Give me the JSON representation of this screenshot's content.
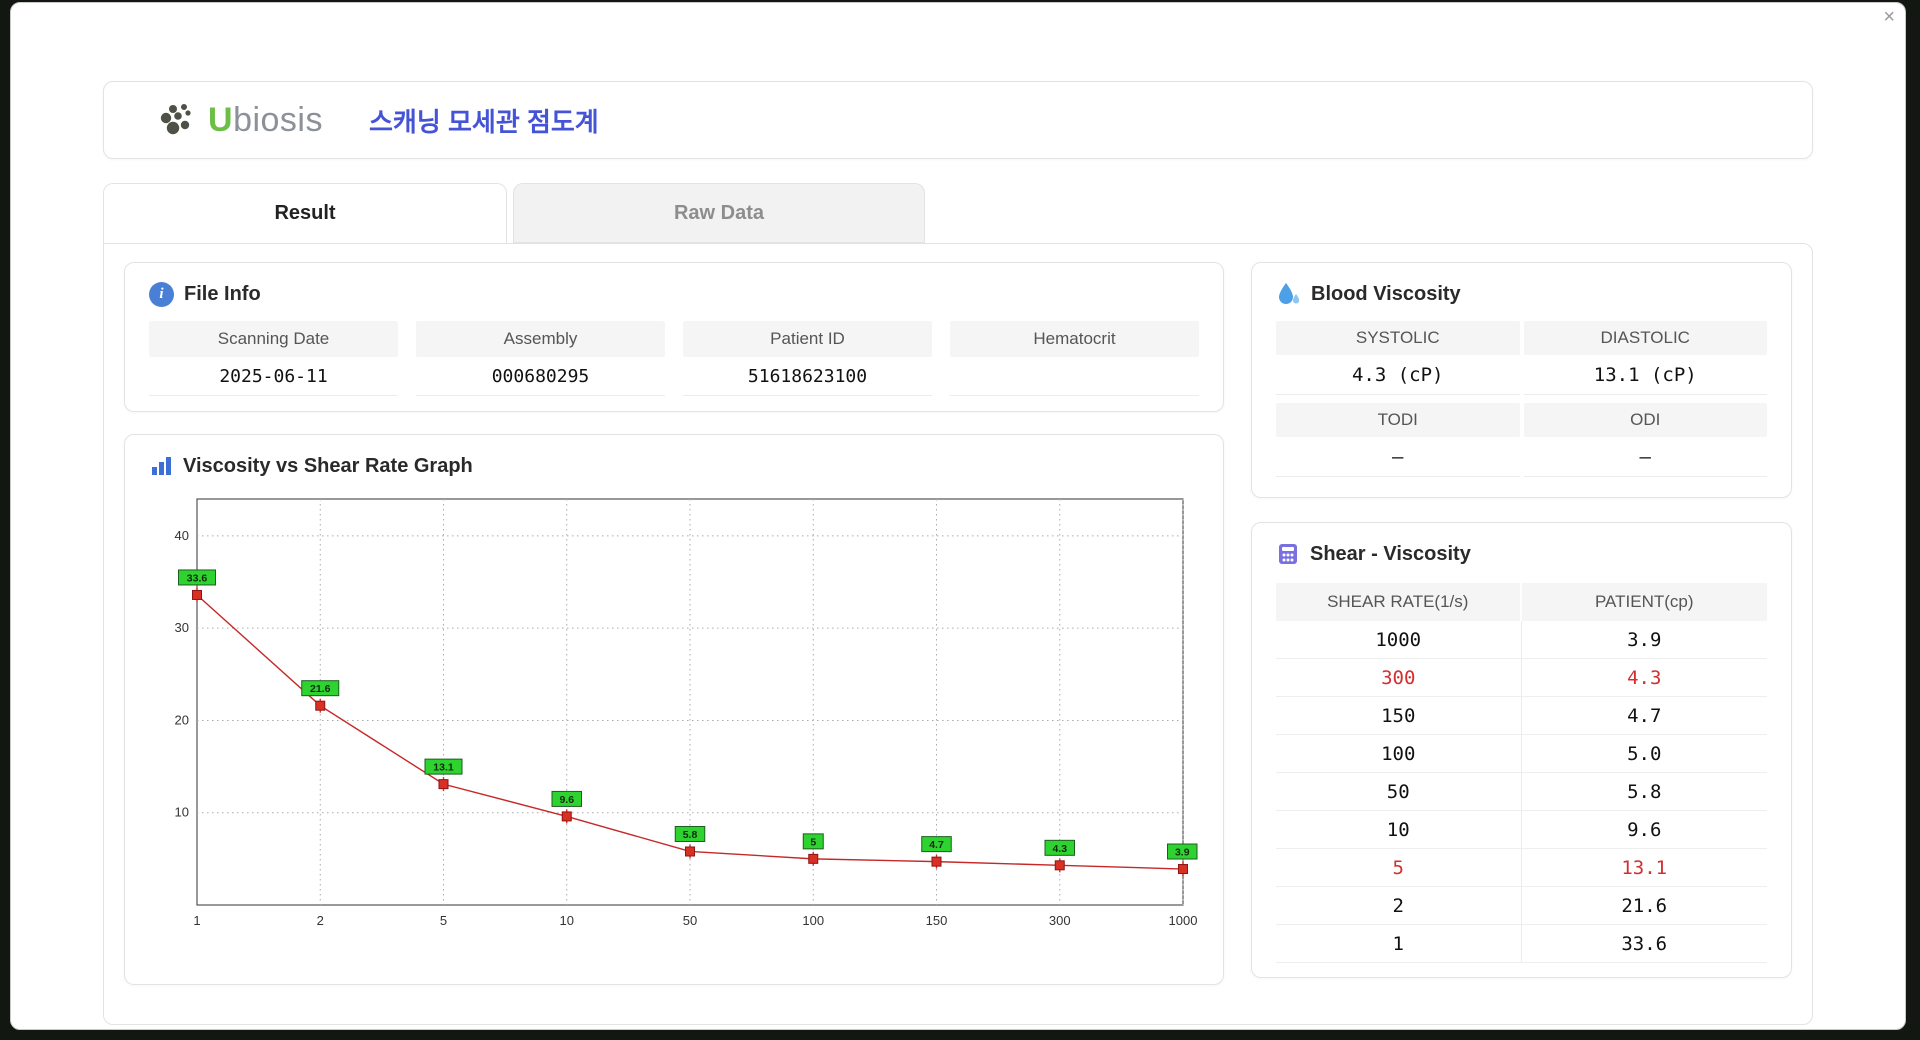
{
  "window": {
    "close_label": "×"
  },
  "header": {
    "brand_first_letter": "U",
    "brand_rest": "biosis",
    "app_title": "스캐닝 모세관 점도계"
  },
  "tabs": [
    {
      "label": "Result",
      "active": true
    },
    {
      "label": "Raw Data",
      "active": false
    }
  ],
  "file_info": {
    "title": "File Info",
    "icon": "info-icon",
    "fields": [
      {
        "label": "Scanning Date",
        "value": "2025-06-11"
      },
      {
        "label": "Assembly",
        "value": "000680295"
      },
      {
        "label": "Patient ID",
        "value": "51618623100"
      },
      {
        "label": "Hematocrit",
        "value": ""
      }
    ]
  },
  "blood_viscosity": {
    "title": "Blood Viscosity",
    "icon": "water-drop-icon",
    "pairs": [
      {
        "label1": "SYSTOLIC",
        "label2": "DIASTOLIC",
        "value1": "4.3 (cP)",
        "value2": "13.1 (cP)"
      },
      {
        "label1": "TODI",
        "label2": "ODI",
        "value1": "–",
        "value2": "–"
      }
    ]
  },
  "graph": {
    "title": "Viscosity vs Shear Rate Graph",
    "icon": "bar-chart-icon"
  },
  "chart_data": {
    "type": "line",
    "title": "Viscosity vs Shear Rate Graph",
    "x_categories": [
      "1",
      "2",
      "5",
      "10",
      "50",
      "100",
      "150",
      "300",
      "1000"
    ],
    "x_values": [
      1,
      2,
      5,
      10,
      50,
      100,
      150,
      300,
      1000
    ],
    "series": [
      {
        "name": "PATIENT",
        "values": [
          33.6,
          21.6,
          13.1,
          9.6,
          5.8,
          5.0,
          4.7,
          4.3,
          3.9
        ]
      }
    ],
    "point_labels": [
      "33.6",
      "21.6",
      "13.1",
      "9.6",
      "5.8",
      "5",
      "4.7",
      "4.3",
      "3.9"
    ],
    "xlabel": "",
    "ylabel": "",
    "yticks": [
      10,
      20,
      30,
      40
    ],
    "ylim": [
      0,
      44
    ],
    "xscale": "log-categorical",
    "grid": "dotted",
    "legend": "none",
    "line_color": "#c62828",
    "marker_color": "#d93025",
    "point_label_bg": "#2fd32f",
    "point_label_border": "#1b5e20"
  },
  "shear_table": {
    "title": "Shear - Viscosity",
    "icon": "table-icon",
    "columns": [
      "SHEAR RATE(1/s)",
      "PATIENT(cp)"
    ],
    "rows": [
      {
        "shear_rate": "1000",
        "patient": "3.9",
        "highlight": false
      },
      {
        "shear_rate": "300",
        "patient": "4.3",
        "highlight": true
      },
      {
        "shear_rate": "150",
        "patient": "4.7",
        "highlight": false
      },
      {
        "shear_rate": "100",
        "patient": "5.0",
        "highlight": false
      },
      {
        "shear_rate": "50",
        "patient": "5.8",
        "highlight": false
      },
      {
        "shear_rate": "10",
        "patient": "9.6",
        "highlight": false
      },
      {
        "shear_rate": "5",
        "patient": "13.1",
        "highlight": true
      },
      {
        "shear_rate": "2",
        "patient": "21.6",
        "highlight": false
      },
      {
        "shear_rate": "1",
        "patient": "33.6",
        "highlight": false
      }
    ],
    "highlight_color": "#d32f2f"
  },
  "colors": {
    "accent_blue": "#4553d6",
    "brand_green": "#6cbf45",
    "red_text": "#d32f2f",
    "label_green": "#2fd32f"
  }
}
